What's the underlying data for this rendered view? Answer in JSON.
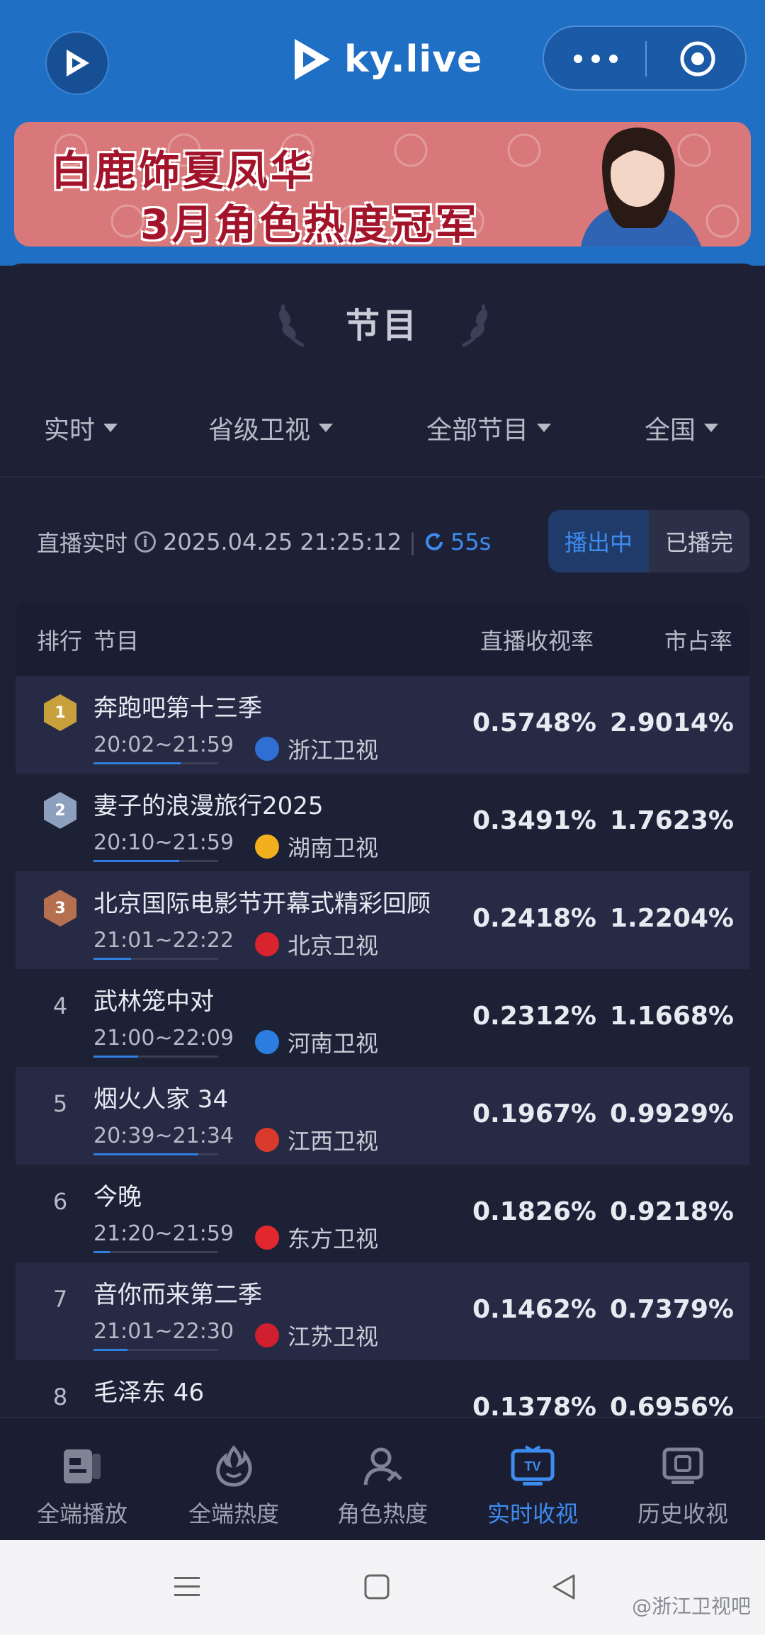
{
  "app": {
    "brand": "ky.live"
  },
  "banner": {
    "line1": "白鹿饰夏凤华",
    "line2": "3月角色热度冠军"
  },
  "section": {
    "title": "节目"
  },
  "filters": [
    {
      "label": "实时"
    },
    {
      "label": "省级卫视"
    },
    {
      "label": "全部节目"
    },
    {
      "label": "全国"
    }
  ],
  "live": {
    "label": "直播实时",
    "datetime": "2025.04.25 21:25:12",
    "refresh": "55s"
  },
  "toggle": {
    "on": "播出中",
    "off": "已播完"
  },
  "table": {
    "headers": {
      "rank": "排行",
      "program": "节目",
      "rating": "直播收视率",
      "share": "市占率"
    },
    "rows": [
      {
        "rank": "1",
        "name": "奔跑吧第十三季",
        "time": "20:02~21:59",
        "channel": "浙江卫视",
        "rating": "0.5748%",
        "share": "2.9014%",
        "progress": 0.7
      },
      {
        "rank": "2",
        "name": "妻子的浪漫旅行2025",
        "time": "20:10~21:59",
        "channel": "湖南卫视",
        "rating": "0.3491%",
        "share": "1.7623%",
        "progress": 0.69
      },
      {
        "rank": "3",
        "name": "北京国际电影节开幕式精彩回顾",
        "time": "21:01~22:22",
        "channel": "北京卫视",
        "rating": "0.2418%",
        "share": "1.2204%",
        "progress": 0.3
      },
      {
        "rank": "4",
        "name": "武林笼中对",
        "time": "21:00~22:09",
        "channel": "河南卫视",
        "rating": "0.2312%",
        "share": "1.1668%",
        "progress": 0.36
      },
      {
        "rank": "5",
        "name": "烟火人家 34",
        "time": "20:39~21:34",
        "channel": "江西卫视",
        "rating": "0.1967%",
        "share": "0.9929%",
        "progress": 0.84
      },
      {
        "rank": "6",
        "name": "今晚",
        "time": "21:20~21:59",
        "channel": "东方卫视",
        "rating": "0.1826%",
        "share": "0.9218%",
        "progress": 0.13
      },
      {
        "rank": "7",
        "name": "音你而来第二季",
        "time": "21:01~22:30",
        "channel": "江苏卫视",
        "rating": "0.1462%",
        "share": "0.7379%",
        "progress": 0.27
      },
      {
        "rank": "8",
        "name": "毛泽东 46",
        "time": "",
        "channel": "",
        "rating": "0.1378%",
        "share": "0.6956%",
        "progress": 0
      }
    ]
  },
  "nav": [
    {
      "label": "全端播放",
      "icon": "playback-icon"
    },
    {
      "label": "全端热度",
      "icon": "flame-icon"
    },
    {
      "label": "角色热度",
      "icon": "person-icon"
    },
    {
      "label": "实时收视",
      "icon": "tv-icon",
      "active": true
    },
    {
      "label": "历史收视",
      "icon": "history-icon"
    }
  ],
  "watermark": "@浙江卫视吧",
  "colors": {
    "accent": "#3d8cf0",
    "header": "#1f6fc5",
    "gold": "#c9a13c",
    "silver": "#8da0bd",
    "bronze": "#b7704f"
  }
}
